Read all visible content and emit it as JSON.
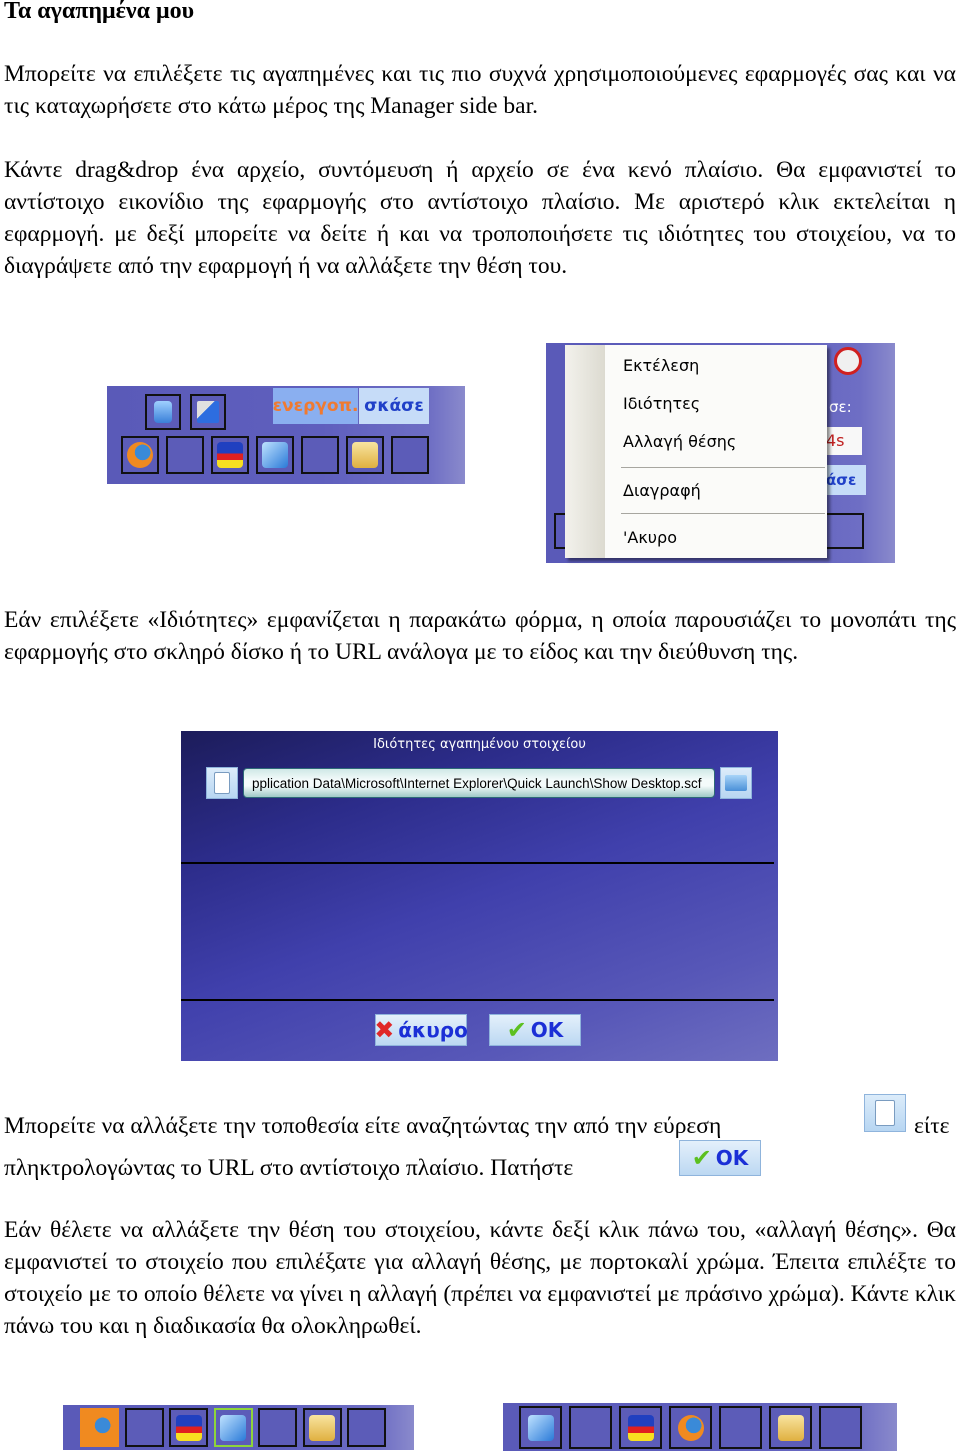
{
  "heading": "Τα αγαπημένα μου",
  "paragraphs": {
    "p1": "Μπορείτε να επιλέξετε τις αγαπημένες και τις πιο συχνά χρησιμοποιούμενες εφαρμογές σας και να τις καταχωρήσετε στο κάτω μέρος της Manager side bar.",
    "p2": "Κάντε drag&drop ένα αρχείο, συντόμευση ή αρχείο σε ένα κενό πλαίσιο. Θα εμφανιστεί το αντίστοιχο εικονίδιο της εφαρμογής στο αντίστοιχο πλαίσιο. Με αριστερό κλικ εκτελείται η εφαρμογή. με δεξί μπορείτε να δείτε ή και να τροποποιήσετε τις ιδιότητες του στοιχείου, να το διαγράψετε από την εφαρμογή ή να αλλάξετε την θέση του.",
    "p3": "Εάν επιλέξετε «Ιδιότητες» εμφανίζεται η παρακάτω φόρμα, η οποία παρουσιάζει το μονοπάτι της εφαρμογής στο σκληρό δίσκο ή το URL ανάλογα με το είδος και την διεύθυνση της.",
    "p4a": "Μπορείτε να αλλάξετε την τοποθεσία είτε αναζητώντας την από την εύρεση",
    "p4b": "είτε",
    "p4c": "πληκτρολογώντας το URL στο αντίστοιχο πλαίσιο. Πατήστε",
    "p5": "Εάν θέλετε να αλλάξετε την θέση του στοιχείου, κάντε δεξί κλικ πάνω του, «αλλαγή θέσης». Θα εμφανιστεί το στοιχείο που επιλέξατε για αλλαγή θέσης, με πορτοκαλί χρώμα. Έπειτα επιλέξτε το στοιχείο με το οποίο θέλετε να γίνει η αλλαγή (πρέπει να εμφανιστεί με πράσινο χρώμα). Κάντε κλικ πάνω του και η διαδικασία θα ολοκληρωθεί."
  },
  "sidebar": {
    "activate_label": "ενεργοπ.",
    "close_label": "σκάσε",
    "top_icons": [
      "computer-icon",
      "wrench-icon"
    ],
    "slots": [
      "firefox-icon",
      "",
      "pacman-game-icon",
      "ie-icon",
      "",
      "folder-icon",
      ""
    ]
  },
  "context_menu": {
    "items": [
      "Εκτέλεση",
      "Ιδιότητες",
      "Αλλαγή θέσης",
      "Διαγραφή",
      "'Ακυρο"
    ],
    "behind_text_1": "σε:",
    "behind_text_2": "4s",
    "behind_text_3": "άσε"
  },
  "dialog": {
    "title": "Ιδιότητες αγαπημένου στοιχείου",
    "path_value": "pplication Data\\Microsoft\\Internet Explorer\\Quick Launch\\Show Desktop.scf",
    "cancel_label": "άκυρο",
    "ok_label": "OK"
  },
  "inline_ok_label": "OK",
  "swap_before": {
    "slots": [
      "firefox-icon",
      "",
      "pacman-game-icon",
      "ie-icon",
      "",
      "folder-icon",
      ""
    ],
    "orange_index": 0,
    "green_index": 3
  },
  "swap_after": {
    "slots": [
      "ie-icon",
      "",
      "pacman-game-icon",
      "firefox-icon",
      "",
      "folder-icon",
      ""
    ]
  },
  "colors": {
    "panel_blue": "#5c5cb8",
    "selected_orange": "#f08a20",
    "target_green": "#8ed43a",
    "button_text_blue": "#1b2fd6"
  }
}
